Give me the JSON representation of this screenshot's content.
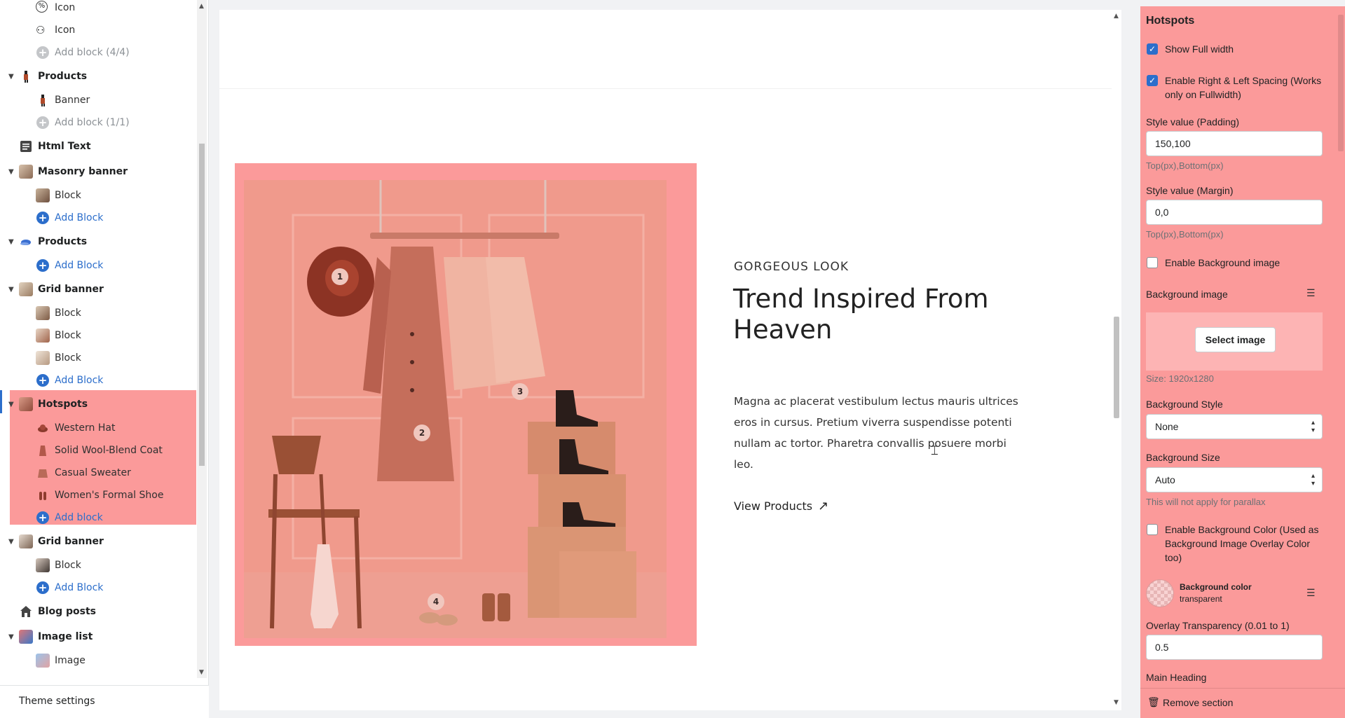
{
  "sidebar": {
    "items": [
      {
        "kind": "block",
        "label": "Icon",
        "icon": "percent-badge-icon"
      },
      {
        "kind": "block",
        "label": "Icon",
        "icon": "chat-user-icon"
      },
      {
        "kind": "add-disabled",
        "label": "Add block (4/4)"
      },
      {
        "kind": "section",
        "label": "Products",
        "icon": "figure-thumb-icon"
      },
      {
        "kind": "block",
        "label": "Banner",
        "icon": "figure-thumb-icon"
      },
      {
        "kind": "add-disabled",
        "label": "Add block (1/1)"
      },
      {
        "kind": "section-plain",
        "label": "Html Text",
        "icon": "text-block-icon"
      },
      {
        "kind": "section",
        "label": "Masonry banner",
        "icon": "photo-thumb-icon"
      },
      {
        "kind": "block",
        "label": "Block",
        "icon": "photo-thumb-icon"
      },
      {
        "kind": "add",
        "label": "Add Block"
      },
      {
        "kind": "section",
        "label": "Products",
        "icon": "cap-thumb-icon"
      },
      {
        "kind": "add",
        "label": "Add Block"
      },
      {
        "kind": "section",
        "label": "Grid banner",
        "icon": "photo-thumb-icon"
      },
      {
        "kind": "block",
        "label": "Block",
        "icon": "photo-thumb-icon"
      },
      {
        "kind": "block",
        "label": "Block",
        "icon": "photo-thumb-icon"
      },
      {
        "kind": "block",
        "label": "Block",
        "icon": "photo-thumb-icon"
      },
      {
        "kind": "add",
        "label": "Add Block"
      },
      {
        "kind": "section",
        "label": "Hotspots",
        "icon": "photo-thumb-icon"
      },
      {
        "kind": "block",
        "label": "Western Hat",
        "icon": "hat-thumb-icon"
      },
      {
        "kind": "block",
        "label": "Solid Wool-Blend Coat",
        "icon": "coat-thumb-icon"
      },
      {
        "kind": "block",
        "label": "Casual Sweater",
        "icon": "sweater-thumb-icon"
      },
      {
        "kind": "block",
        "label": "Women's Formal Shoe",
        "icon": "shoe-thumb-icon"
      },
      {
        "kind": "add",
        "label": "Add block"
      },
      {
        "kind": "section",
        "label": "Grid banner",
        "icon": "photo-thumb-icon"
      },
      {
        "kind": "block",
        "label": "Block",
        "icon": "photo-thumb-icon"
      },
      {
        "kind": "add",
        "label": "Add Block"
      },
      {
        "kind": "section-plain",
        "label": "Blog posts",
        "icon": "home-icon"
      },
      {
        "kind": "section",
        "label": "Image list",
        "icon": "photo-thumb-icon"
      },
      {
        "kind": "block",
        "label": "Image",
        "icon": "photo-thumb-icon"
      }
    ],
    "theme_settings": "Theme settings"
  },
  "preview": {
    "eyebrow": "GORGEOUS LOOK",
    "heading": "Trend Inspired From Heaven",
    "body": "Magna ac placerat vestibulum lectus mauris ultrices eros in cursus. Pretium viverra suspendisse potenti nullam ac tortor. Pharetra convallis posuere morbi leo.",
    "link": "View Products",
    "hotspots": [
      "1",
      "2",
      "3",
      "4"
    ]
  },
  "panel": {
    "title": "Hotspots",
    "show_full_width": "Show Full width",
    "spacing": "Enable Right & Left Spacing (Works only on Fullwidth)",
    "padding_label": "Style value (Padding)",
    "padding_value": "150,100",
    "padding_help": "Top(px),Bottom(px)",
    "margin_label": "Style value (Margin)",
    "margin_value": "0,0",
    "margin_help": "Top(px),Bottom(px)",
    "enable_bg_image": "Enable Background image",
    "bg_image_label": "Background image",
    "select_image": "Select image",
    "size": "Size: 1920x1280",
    "bg_style_label": "Background Style",
    "bg_style_value": "None",
    "bg_size_label": "Background Size",
    "bg_size_value": "Auto",
    "parallax_help": "This will not apply for parallax",
    "enable_bg_color": "Enable Background Color (Used as Background Image Overlay Color too)",
    "bg_color_label": "Background color",
    "bg_color_value": "transparent",
    "overlay_label": "Overlay Transparency (0.01 to 1)",
    "overlay_value": "0.5",
    "main_heading_label": "Main Heading",
    "remove": "Remove section"
  },
  "colors": {
    "accent": "#2c6ecb",
    "highlight": "#fb9a9a"
  }
}
